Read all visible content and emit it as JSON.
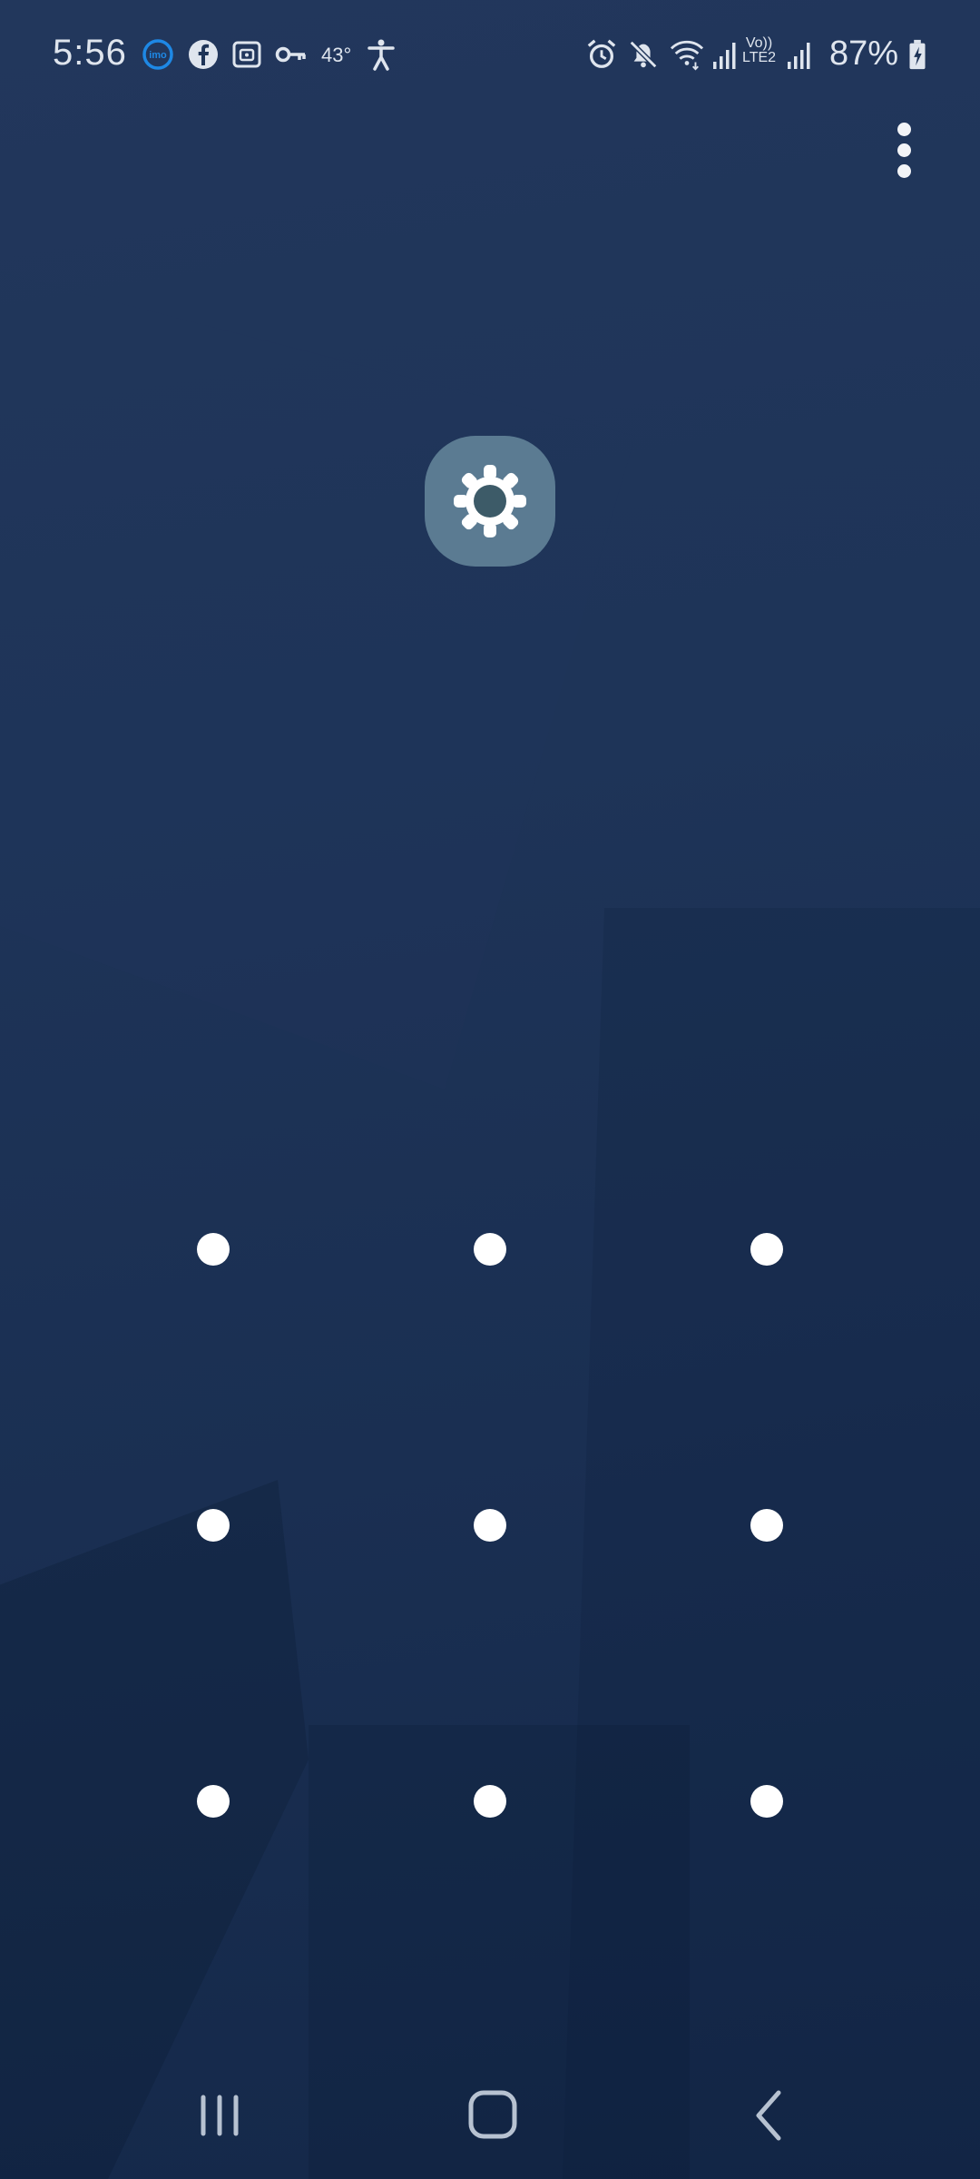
{
  "status_bar": {
    "time": "5:56",
    "temperature": "43°",
    "lte_label_top": "Vo))",
    "lte_label_bottom": "LTE2",
    "battery": "87%",
    "icons": [
      "imo-icon",
      "facebook-icon",
      "secure-folder-icon",
      "vpn-key-icon",
      "accessibility-icon",
      "alarm-icon",
      "mute-icon",
      "wifi-icon",
      "signal-icon",
      "signal-icon",
      "battery-charging-icon"
    ]
  },
  "colors": {
    "background": "#1e3458",
    "app_icon_bg": "#5b7b92",
    "dot": "#ffffff",
    "imo_accent": "#1e88e5"
  },
  "lock_screen": {
    "app_icon": "settings-gear-icon",
    "pattern_grid": {
      "rows": 3,
      "cols": 3
    }
  },
  "nav_bar": {
    "buttons": [
      "recent-apps-icon",
      "home-icon",
      "back-icon"
    ]
  }
}
